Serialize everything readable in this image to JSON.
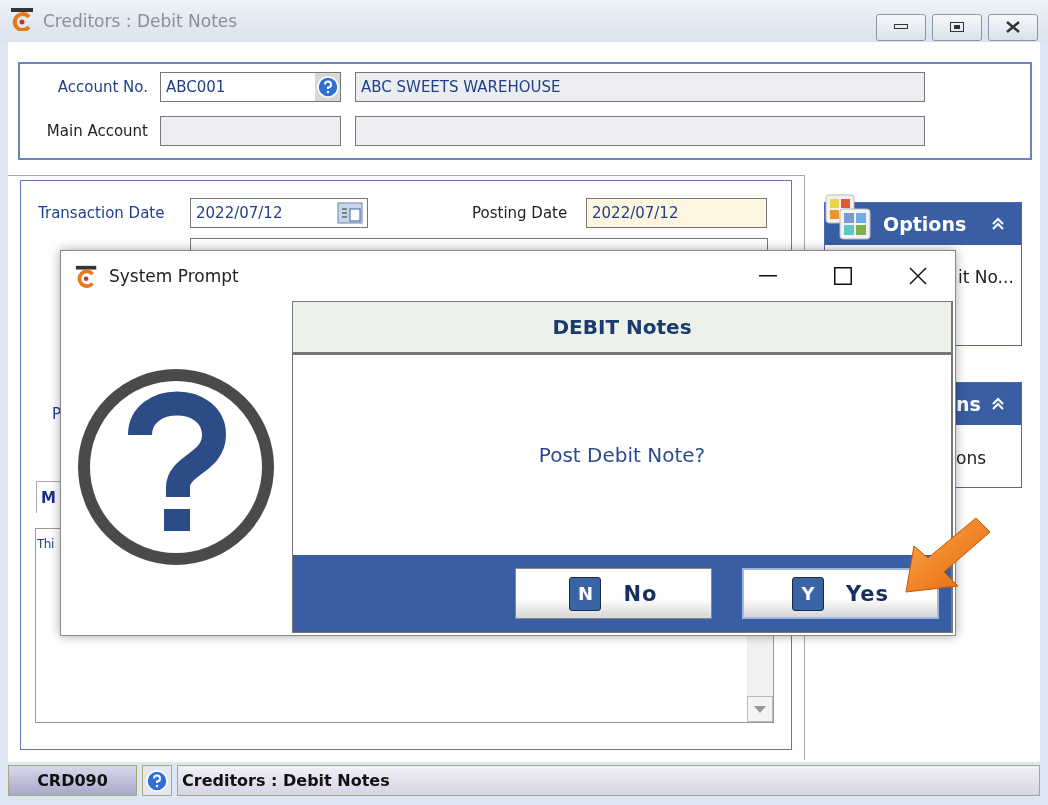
{
  "window": {
    "title": "Creditors : Debit Notes"
  },
  "account": {
    "account_no_label": "Account No.",
    "account_no": "ABC001",
    "account_name": "ABC SWEETS WAREHOUSE",
    "main_account_label": "Main Account"
  },
  "transaction": {
    "transaction_date_label": "Transaction Date",
    "transaction_date": "2022/07/12",
    "posting_date_label": "Posting Date",
    "posting_date": "2022/07/12",
    "field_label_fragment": "P",
    "tab_fragment": "M",
    "notes_fragment": "Thi"
  },
  "side_panels": [
    {
      "title": "Options",
      "item": "it No..."
    },
    {
      "title": "ns",
      "item": "ons"
    }
  ],
  "status_bar": {
    "code": "CRD090",
    "title": "Creditors : Debit Notes"
  },
  "dialog": {
    "title": "System Prompt",
    "heading": "DEBIT Notes",
    "message": "Post Debit Note?",
    "buttons": [
      {
        "key": "N",
        "label": "No",
        "selected": false
      },
      {
        "key": "Y",
        "label": "Yes",
        "selected": true
      }
    ]
  }
}
